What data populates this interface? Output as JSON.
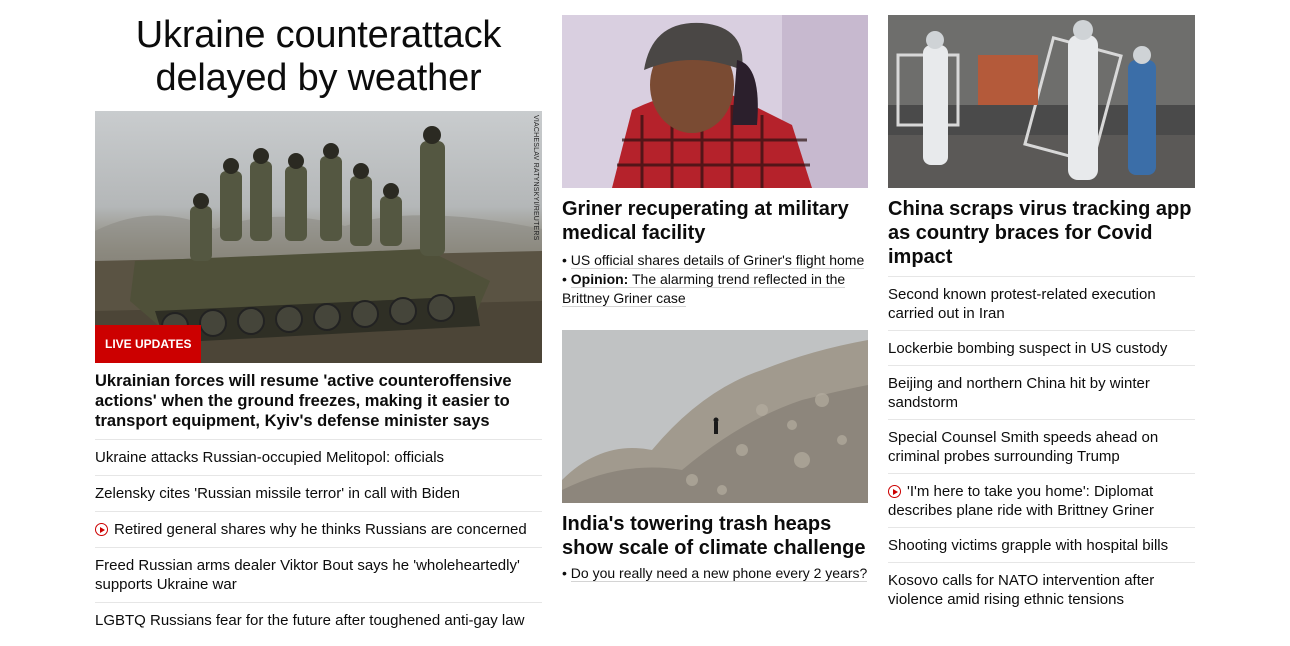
{
  "col1": {
    "headline": "Ukraine counterattack delayed by weather",
    "photo_credit": "VIACHESLAV RATYNSKYI/REUTERS",
    "badge": "LIVE UPDATES",
    "caption": "Ukrainian forces will resume 'active counteroffensive actions' when the ground freezes, making it easier to transport equipment, Kyiv's defense minister says",
    "items": [
      {
        "text": "Ukraine attacks Russian-occupied Melitopol: officials",
        "video": false
      },
      {
        "text": "Zelensky cites 'Russian missile terror' in call with Biden",
        "video": false
      },
      {
        "text": "Retired general shares why he thinks Russians are concerned",
        "video": true
      },
      {
        "text": "Freed Russian arms dealer Viktor Bout says he 'wholeheartedly' supports Ukraine war",
        "video": false
      },
      {
        "text": "LGBTQ Russians fear for the future after toughened anti-gay law",
        "video": false
      }
    ]
  },
  "col2": {
    "card1": {
      "title": "Griner recuperating at military medical facility",
      "bullet1": "US official shares details of Griner's flight home",
      "bullet2_label": "Opinion:",
      "bullet2_text": "The alarming trend reflected in the Brittney Griner case"
    },
    "card2": {
      "title": "India's towering trash heaps show scale of climate challenge",
      "bullet1": "Do you really need a new phone every 2 years?"
    }
  },
  "col3": {
    "title": "China scraps virus tracking app as country braces for Covid impact",
    "items": [
      {
        "text": "Second known protest-related execution carried out in Iran",
        "video": false
      },
      {
        "text": "Lockerbie bombing suspect in US custody",
        "video": false
      },
      {
        "text": "Beijing and northern China hit by winter sandstorm",
        "video": false
      },
      {
        "text": "Special Counsel Smith speeds ahead on criminal probes surrounding Trump",
        "video": false
      },
      {
        "text": "'I'm here to take you home': Diplomat describes plane ride with Brittney Griner",
        "video": true
      },
      {
        "text": "Shooting victims grapple with hospital bills",
        "video": false
      },
      {
        "text": "Kosovo calls for NATO intervention after violence amid rising ethnic tensions",
        "video": false
      }
    ]
  },
  "colors": {
    "accent_red": "#cc0000",
    "text": "#0c0c0c",
    "divider": "#e6e6e6"
  },
  "icons": {
    "video": "play-circle-icon"
  }
}
